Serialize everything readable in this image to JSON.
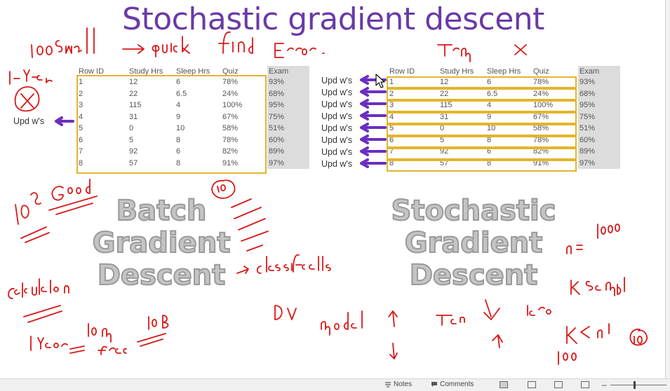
{
  "slide": {
    "title": "Stochastic gradient descent",
    "table_headers": [
      "Row ID",
      "Study Hrs",
      "Sleep Hrs",
      "Quiz",
      "Exam"
    ],
    "table_rows": [
      [
        "1",
        "12",
        "6",
        "78%",
        "93%"
      ],
      [
        "2",
        "22",
        "6.5",
        "24%",
        "68%"
      ],
      [
        "3",
        "115",
        "4",
        "100%",
        "95%"
      ],
      [
        "4",
        "31",
        "9",
        "67%",
        "75%"
      ],
      [
        "5",
        "0",
        "10",
        "58%",
        "51%"
      ],
      [
        "6",
        "5",
        "8",
        "78%",
        "60%"
      ],
      [
        "7",
        "92",
        "6",
        "82%",
        "89%"
      ],
      [
        "8",
        "57",
        "8",
        "91%",
        "97%"
      ]
    ],
    "upd_label": "Upd w's",
    "batch_lines": [
      "Batch",
      "Gradient",
      "Descent"
    ],
    "sgd_lines": [
      "Stochastic",
      "Gradient",
      "Descent"
    ]
  },
  "annotations": {
    "ink_color": "#d81818",
    "arrow_color": "#6a2fc0",
    "notes": [
      "100 small",
      "quick",
      "find",
      "Error",
      "1-year",
      "10^8",
      "Good",
      "calculation",
      "1 Year",
      "10 m",
      "frac",
      "10B",
      "classification",
      "model",
      "low",
      "loss",
      "n = 1000",
      "K sample",
      "K < n",
      "100",
      "10"
    ]
  },
  "statusbar": {
    "notes_label": "Notes",
    "comments_label": "Comments"
  },
  "colors": {
    "title": "#6a3aa8",
    "highlight": "#e3b52a",
    "exam_column": "#dcdcdc"
  }
}
